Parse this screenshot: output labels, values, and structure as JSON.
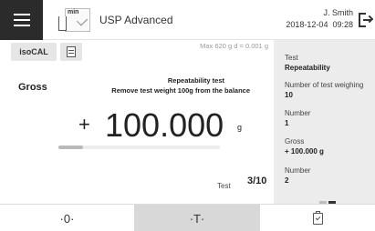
{
  "header": {
    "method_icon_text": "min",
    "method_title": "USP Advanced",
    "user": "J. Smith",
    "date": "2018-12-04",
    "time": "09:28",
    "icons": [
      "menu-icon",
      "method-icon",
      "logout-icon"
    ]
  },
  "toolbar": {
    "isocal_label": "isoCAL",
    "icons": [
      "document-icon"
    ]
  },
  "balance_info": "Max 620 g    d = 0.001 g",
  "display": {
    "mode_label": "Gross",
    "instruction_title": "Repeatability test",
    "instruction_text": "Remove test weight 100g from the balance",
    "sign": "+",
    "value": "100.000",
    "unit": "g",
    "progress": 0.15
  },
  "test_info": {
    "label": "Test",
    "count": "3/10"
  },
  "side_panel": [
    {
      "label": "Test",
      "value": "Repeatability"
    },
    {
      "label": "Number of test weighing",
      "value": "10"
    },
    {
      "label": "Number",
      "value": "1"
    },
    {
      "label": "Gross",
      "value": "+ 100.000 g"
    },
    {
      "label": "Number",
      "value": "2"
    }
  ],
  "softkeys": {
    "zero_label": "·0·",
    "tare_label": "·T·",
    "done_icon": "clipboard-check-icon"
  }
}
